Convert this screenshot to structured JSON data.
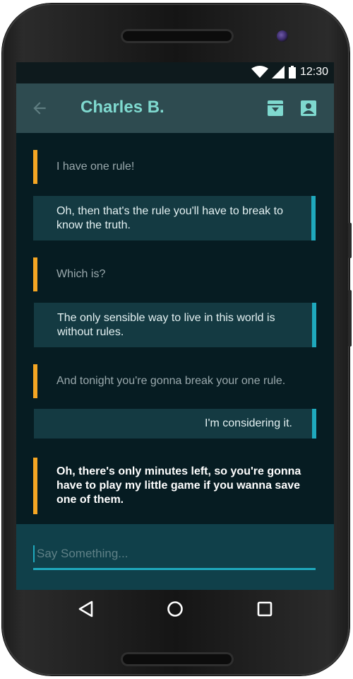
{
  "status_bar": {
    "time": "12:30"
  },
  "toolbar": {
    "title": "Charles B.",
    "icons": [
      "back-arrow-icon",
      "archive-icon",
      "contact-icon"
    ]
  },
  "messages": [
    {
      "direction": "incoming",
      "text": "I have one rule!"
    },
    {
      "direction": "outgoing",
      "text": "Oh, then that's the rule you'll have to break to know the truth."
    },
    {
      "direction": "incoming",
      "text": "Which is?"
    },
    {
      "direction": "outgoing",
      "text": "The only sensible way to live in this world is without rules."
    },
    {
      "direction": "incoming",
      "text": "And tonight you're gonna break your one rule."
    },
    {
      "direction": "outgoing",
      "text": "I'm considering it."
    },
    {
      "direction": "incoming",
      "text": "Oh, there's only minutes left, so you're gonna have to play my little game if you wanna save one of them."
    }
  ],
  "compose": {
    "placeholder": "Say Something..."
  },
  "nav": {
    "icons": [
      "back-triangle-icon",
      "home-circle-icon",
      "recents-square-icon"
    ]
  },
  "colors": {
    "incoming_accent": "#f5a623",
    "outgoing_accent": "#1fa9bd",
    "title": "#7fd9cf",
    "toolbar_bg": "#2e4b50",
    "screen_bg": "#061c22"
  }
}
